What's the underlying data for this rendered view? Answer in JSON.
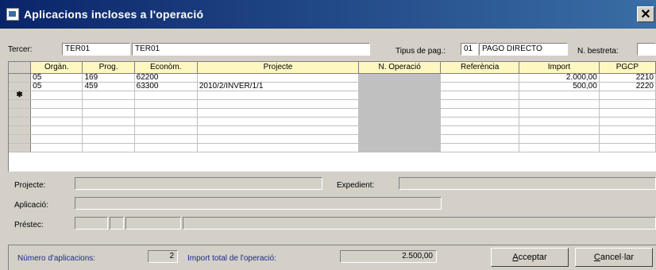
{
  "window": {
    "title": "Aplicacions incloses a l'operació",
    "close_glyph": "✕"
  },
  "header": {
    "tercer_label": "Tercer:",
    "tercer_code": "TER01",
    "tercer_name": "TER01",
    "tipus_pag_label": "Tipus de pag.:",
    "tipus_pag_code": "01",
    "tipus_pag_name": "PAGO DIRECTO",
    "n_bestreta_label": "N. bestreta:",
    "n_bestreta_value": ""
  },
  "grid": {
    "columns": [
      "Orgàn.",
      "Prog.",
      "Econòm.",
      "Projecte",
      "N. Operació",
      "Referència",
      "Import",
      "PGCP"
    ],
    "rows": [
      {
        "marker": "",
        "cells": [
          "05",
          "169",
          "62200",
          "",
          "",
          "",
          "2.000,00",
          "2210"
        ]
      },
      {
        "marker": "",
        "cells": [
          "05",
          "459",
          "63300",
          "2010/2/INVER/1/1",
          "",
          "",
          "500,00",
          "2220"
        ]
      },
      {
        "marker": "✱",
        "cells": [
          "",
          "",
          "",
          "",
          "",
          "",
          "",
          ""
        ]
      },
      {
        "marker": "",
        "cells": [
          "",
          "",
          "",
          "",
          "",
          "",
          "",
          ""
        ]
      },
      {
        "marker": "",
        "cells": [
          "",
          "",
          "",
          "",
          "",
          "",
          "",
          ""
        ]
      },
      {
        "marker": "",
        "cells": [
          "",
          "",
          "",
          "",
          "",
          "",
          "",
          ""
        ]
      },
      {
        "marker": "",
        "cells": [
          "",
          "",
          "",
          "",
          "",
          "",
          "",
          ""
        ]
      },
      {
        "marker": "",
        "cells": [
          "",
          "",
          "",
          "",
          "",
          "",
          "",
          ""
        ]
      },
      {
        "marker": "",
        "cells": [
          "",
          "",
          "",
          "",
          "",
          "",
          "",
          ""
        ]
      }
    ]
  },
  "details": {
    "projecte_label": "Projecte:",
    "projecte_value": "",
    "expedient_label": "Expedient:",
    "expedient_value": "",
    "aplicacio_label": "Aplicació:",
    "aplicacio_value": "",
    "prestec_label": "Préstec:",
    "prestec_values": [
      "",
      "",
      "",
      ""
    ]
  },
  "footer": {
    "num_aplicacions_label": "Número d'aplicacions:",
    "num_aplicacions_value": "2",
    "import_total_label": "Import total de l'operació:",
    "import_total_value": "2.500,00",
    "accept_hotkey": "A",
    "accept_rest": "cceptar",
    "cancel_hotkey": "C",
    "cancel_rest": "ancel·lar"
  }
}
